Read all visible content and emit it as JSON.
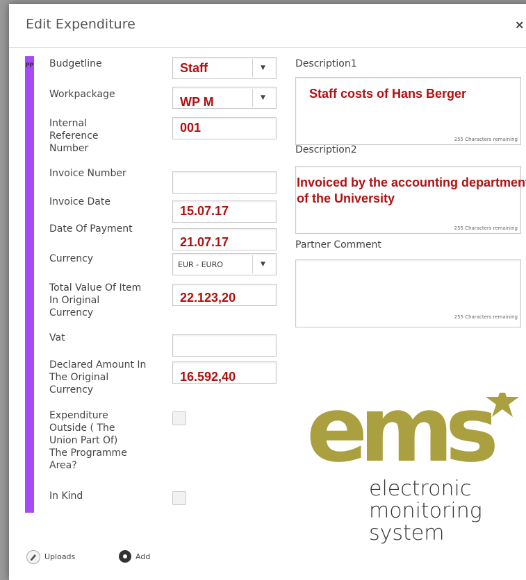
{
  "dialog": {
    "title": "Edit Expenditure",
    "close_glyph": "×"
  },
  "side_tag": "PP",
  "labels": {
    "budgetline": "Budgetline",
    "workpackage": "Workpackage",
    "internal_ref": "Internal Reference Number",
    "invoice_number": "Invoice Number",
    "invoice_date": "Invoice Date",
    "date_of_payment": "Date Of Payment",
    "currency": "Currency",
    "total_value": "Total Value Of Item In Original Currency",
    "vat": "Vat",
    "declared_amount": "Declared Amount In The Original Currency",
    "outside_area": "Expenditure Outside ( The Union Part Of) The Programme Area?",
    "in_kind": "In Kind",
    "description1": "Description1",
    "description2": "Description2",
    "partner_comment": "Partner Comment"
  },
  "values": {
    "budgetline": "Staff",
    "workpackage": "WP M",
    "internal_ref": "001",
    "invoice_number": "",
    "invoice_date": "15.07.17",
    "date_of_payment": "21.07.17",
    "currency": "EUR - EURO",
    "total_value": "22.123,20",
    "vat": "",
    "declared_amount": "16.592,40",
    "description1": "Staff costs of Hans Berger",
    "description2": "Invoiced by the accounting department of the University",
    "partner_comment": ""
  },
  "remaining_text": "255 Characters remaining",
  "buttons": {
    "uploads": "Uploads",
    "add": "Add"
  },
  "logo": {
    "wordmark": "ems",
    "tagline_1": "electronic",
    "tagline_2": "monitoring",
    "tagline_3": "system",
    "color": "#aaa040"
  },
  "colors": {
    "accent_purple": "#a64af5",
    "value_red": "#b01010"
  }
}
